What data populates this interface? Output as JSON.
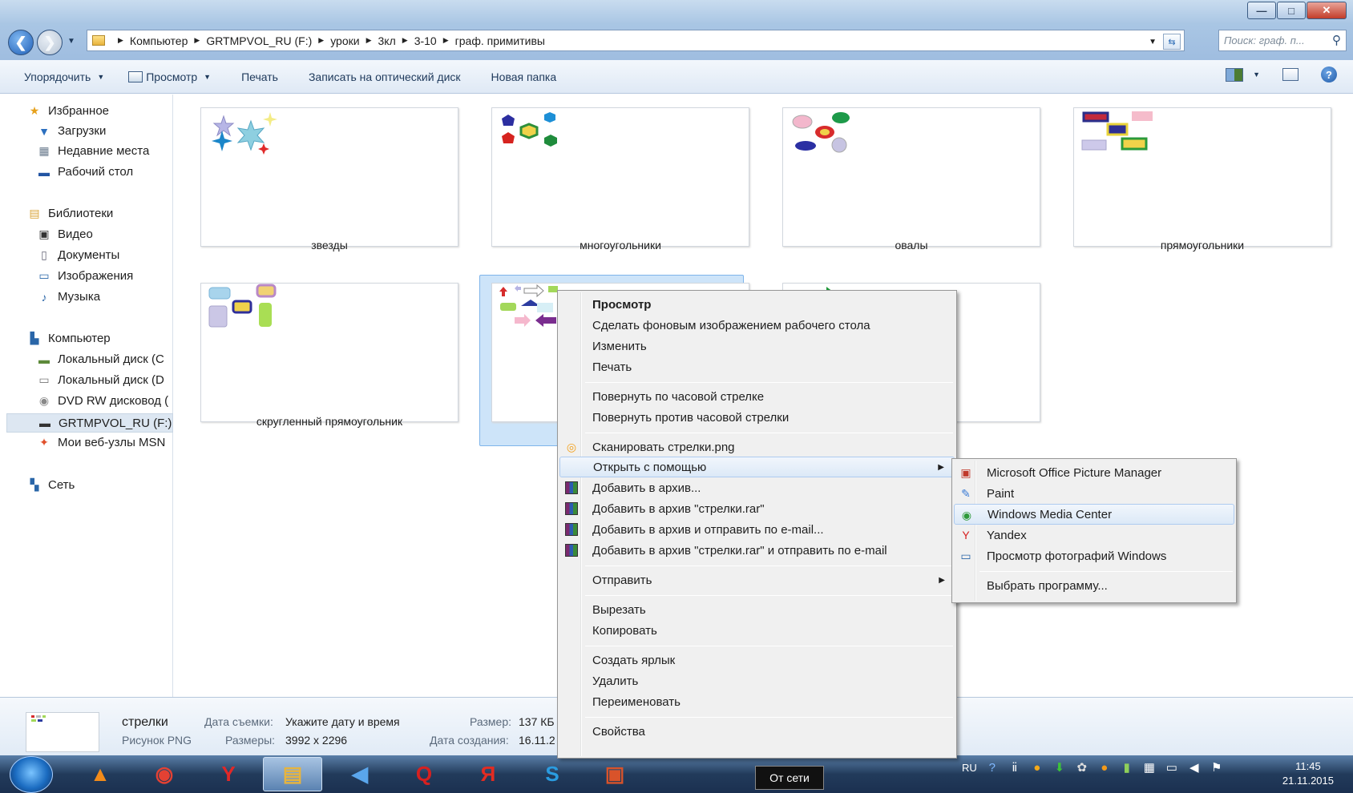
{
  "window": {
    "minimize": "—",
    "maximize": "□",
    "close": "✕",
    "breadcrumbs": [
      "Компьютер",
      "GRTMPVOL_RU (F:)",
      "уроки",
      "3кл",
      "3-10",
      "граф. примитивы"
    ],
    "search_placeholder": "Поиск: граф. п..."
  },
  "toolbar": {
    "organize": "Упорядочить",
    "view": "Просмотр",
    "print": "Печать",
    "burn": "Записать на оптический диск",
    "new_folder": "Новая папка"
  },
  "sidebar": {
    "favorites": "Избранное",
    "downloads": "Загрузки",
    "recent": "Недавние места",
    "desktop": "Рабочий стол",
    "libraries": "Библиотеки",
    "video": "Видео",
    "documents": "Документы",
    "images": "Изображения",
    "music": "Музыка",
    "computer": "Компьютер",
    "local_c": "Локальный диск (C",
    "local_d": "Локальный диск (D",
    "dvd": "DVD RW дисковод (",
    "flash": "GRTMPVOL_RU (F:)",
    "msn": "Мои веб-узлы MSN",
    "network": "Сеть"
  },
  "files": {
    "f1": "звезды",
    "f2": "многоугольники",
    "f3": "овалы",
    "f4": "прямоугольники",
    "f5": "скругленный прямоугольник"
  },
  "context_menu": {
    "preview": "Просмотр",
    "set_wallpaper": "Сделать фоновым изображением рабочего стола",
    "edit": "Изменить",
    "print": "Печать",
    "rotate_cw": "Повернуть по часовой стрелке",
    "rotate_ccw": "Повернуть против часовой стрелки",
    "scan": "Сканировать стрелки.png",
    "open_with": "Открыть с помощью",
    "add_archive": "Добавить в архив...",
    "add_archive_named": "Добавить в архив \"стрелки.rar\"",
    "add_archive_email": "Добавить в архив и отправить по e-mail...",
    "add_archive_named_email": "Добавить в архив \"стрелки.rar\" и отправить по e-mail",
    "send_to": "Отправить",
    "cut": "Вырезать",
    "copy": "Копировать",
    "create_shortcut": "Создать ярлык",
    "delete": "Удалить",
    "rename": "Переименовать",
    "properties": "Свойства"
  },
  "submenu": {
    "office_picture": "Microsoft Office Picture Manager",
    "paint": "Paint",
    "wmc": "Windows Media Center",
    "yandex": "Yandex",
    "photo_viewer": "Просмотр фотографий Windows",
    "choose": "Выбрать программу..."
  },
  "details": {
    "name": "стрелки",
    "type": "Рисунок PNG",
    "date_taken_label": "Дата съемки:",
    "date_taken_value": "Укажите дату и время",
    "dims_label": "Размеры:",
    "dims_value": "3992 x 2296",
    "size_label": "Размер:",
    "size_value": "137 КБ",
    "created_label": "Дата создания:",
    "created_value": "16.11.2"
  },
  "taskbar": {
    "tooltip": "От сети",
    "lang": "RU",
    "time": "11:45",
    "date": "21.11.2015"
  }
}
